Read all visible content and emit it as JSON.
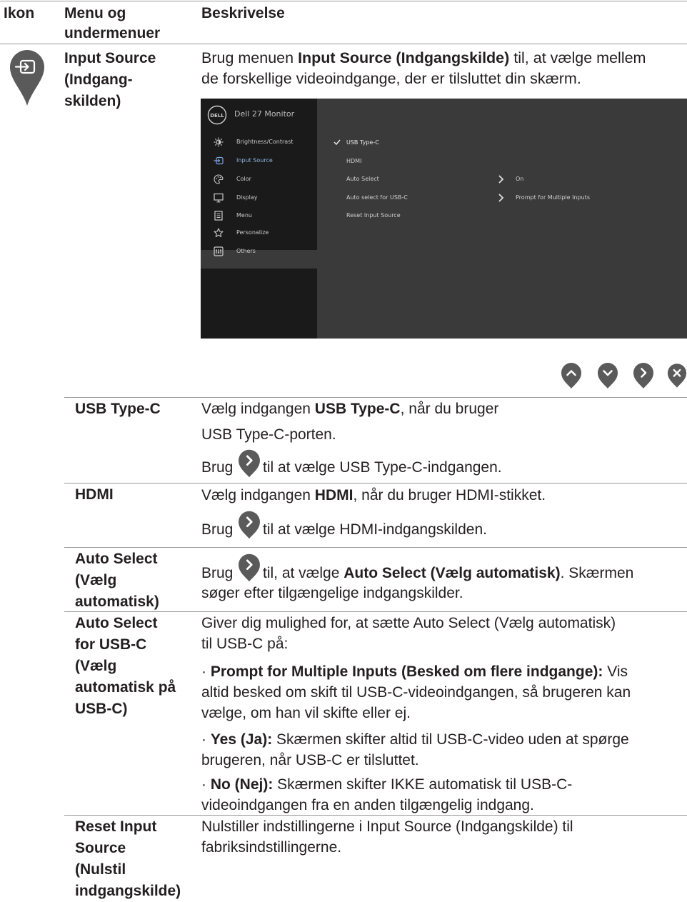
{
  "header": {
    "col1": "Ikon",
    "col2": "Menu og undermenuer",
    "col3": "Beskrivelse"
  },
  "section": {
    "name": "Input Source (Indgang-skilden)",
    "name_lines": [
      "Input Source",
      "(Indgang-",
      "skilden)"
    ],
    "desc_prefix": "Brug menuen ",
    "desc_bold": "Input Source (Indgangskilde)",
    "desc_suffix": " til, at vælge mellem de forskellige videoindgange, der er tilsluttet din skærm.",
    "desc_line1_suffix": " til, at vælge mellem",
    "desc_line2": "de forskellige videoindgange, der er tilsluttet din skærm."
  },
  "osd": {
    "brand": "DELL",
    "title": "Dell 27 Monitor",
    "menu": [
      {
        "label": "Brightness/Contrast",
        "icon": "brightness-icon"
      },
      {
        "label": "Input Source",
        "icon": "input-source-icon"
      },
      {
        "label": "Color",
        "icon": "color-icon"
      },
      {
        "label": "Display",
        "icon": "display-icon"
      },
      {
        "label": "Menu",
        "icon": "menu-icon"
      },
      {
        "label": "Personalize",
        "icon": "star-icon"
      },
      {
        "label": "Others",
        "icon": "others-icon"
      }
    ],
    "submenu": [
      {
        "label": "USB Type-C",
        "value": ""
      },
      {
        "label": "HDMI",
        "value": ""
      },
      {
        "label": "Auto Select",
        "value": "On"
      },
      {
        "label": "Auto select for USB-C",
        "value": "Prompt for Multiple Inputs"
      },
      {
        "label": "Reset Input Source",
        "value": ""
      }
    ]
  },
  "nav_buttons": [
    "up-icon",
    "down-icon",
    "right-icon",
    "close-icon"
  ],
  "rows": {
    "usbc": {
      "name": "USB Type-C",
      "l1_pre": "Vælg indgangen ",
      "l1_bold": "USB Type-C",
      "l1_post": ", når du bruger",
      "l2": "USB Type-C-porten.",
      "l3_pre": "Brug",
      "l3_post": "til at vælge USB Type-C-indgangen."
    },
    "hdmi": {
      "name": "HDMI",
      "l1_pre": "Vælg indgangen ",
      "l1_bold": "HDMI",
      "l1_post": ", når du bruger HDMI-stikket.",
      "l2_pre": "Brug",
      "l2_post": "til at vælge HDMI-indgangskilden."
    },
    "auto": {
      "name_lines": [
        "Auto Select",
        "(Vælg",
        "automatisk)"
      ],
      "l1_pre": "Brug",
      "l1_mid": "til, at vælge ",
      "l1_bold": "Auto Select (Vælg automatisk)",
      "l1_post": ". Skærmen",
      "l2": "søger efter tilgængelige indgangskilder."
    },
    "autousbc": {
      "name_lines": [
        "Auto Select",
        "for USB-C",
        "(Vælg",
        "automatisk på",
        "USB-C)"
      ],
      "p1a": "Giver dig mulighed for, at sætte Auto Select (Vælg automatisk)",
      "p1b": "til USB-C på:",
      "b1_bold": "Prompt for Multiple Inputs (Besked om flere indgange):",
      "b1_a": " Vis",
      "b1_b": "altid besked om skift til USB-C-videoindgangen, så brugeren kan",
      "b1_c": "vælge, om han vil skifte eller ej.",
      "b2_bold": "Yes (Ja):",
      "b2_a": " Skærmen skifter altid til USB-C-video uden at spørge",
      "b2_b": "brugeren, når USB-C er tilsluttet.",
      "b3_bold": "No (Nej):",
      "b3_a": " Skærmen skifter IKKE automatisk til USB-C-",
      "b3_b": "videoindgangen fra en anden tilgængelig indgang."
    },
    "reset": {
      "name_lines": [
        "Reset Input",
        "Source",
        "(Nulstil",
        "indgangskilde)"
      ],
      "l1": "Nulstiller indstillingerne i Input Source (Indgangskilde) til",
      "l2": "fabriksindstillingerne."
    }
  },
  "colors": {
    "pin": "#5a5a5a",
    "osd_bg": "#3a3a3a",
    "osd_left": "#1a1a1a"
  }
}
